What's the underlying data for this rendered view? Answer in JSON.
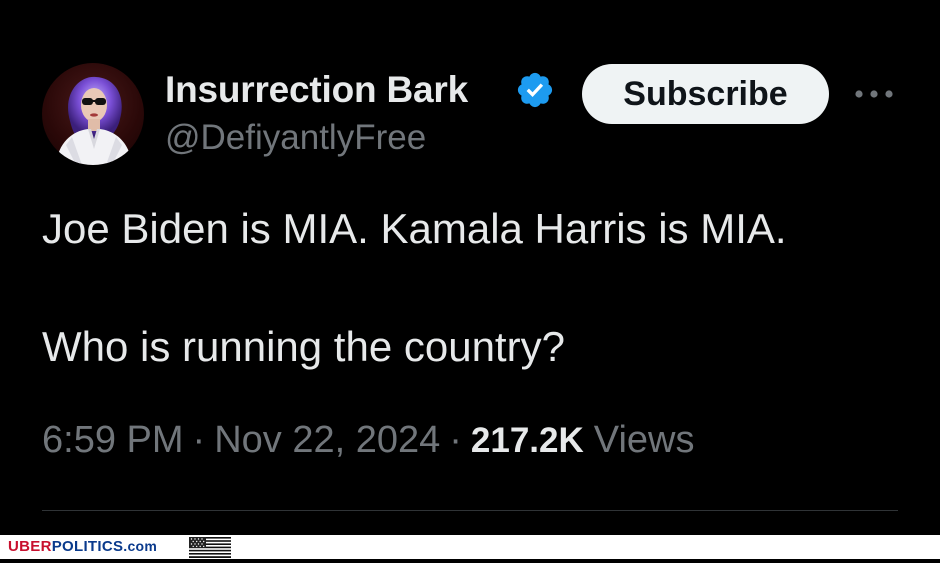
{
  "tweet": {
    "author": {
      "display_name": "Insurrection Bark",
      "handle": "@DefiyantlyFree",
      "verified_icon": "verified-badge-icon",
      "verified_color": "#1d9bf0"
    },
    "subscribe_label": "Subscribe",
    "more_icon": "more-horizontal-icon",
    "text_lines": [
      "Joe Biden is MIA. Kamala Harris is MIA.",
      "Who is running the country?"
    ],
    "time": "6:59 PM",
    "date": "Nov 22, 2024",
    "separator": "·",
    "views_count": "217.2K",
    "views_label": "Views"
  },
  "watermark": {
    "part1": "UBER",
    "part2": "POLITICS",
    "part3": ".com",
    "icon": "us-flag-icon"
  },
  "colors": {
    "background": "#000000",
    "primary_text": "#e7e9ea",
    "secondary_text": "#71767b",
    "button_bg": "#eff3f4",
    "brand_red": "#c8102e",
    "brand_blue": "#0a3a8c"
  }
}
